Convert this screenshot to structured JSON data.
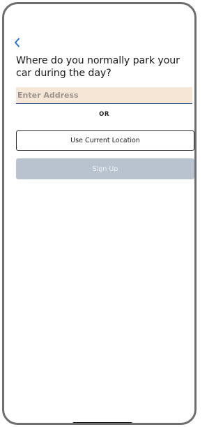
{
  "nav": {
    "back_icon": "chevron-left-icon",
    "accent_color": "#1a6ae0"
  },
  "title": "Where do you normally park your car during the day?",
  "address": {
    "placeholder": "Enter Address",
    "value": ""
  },
  "divider_text": "OR",
  "current_location_label": "Use Current Location",
  "signup": {
    "label": "Sign Up",
    "state": "disabled"
  }
}
